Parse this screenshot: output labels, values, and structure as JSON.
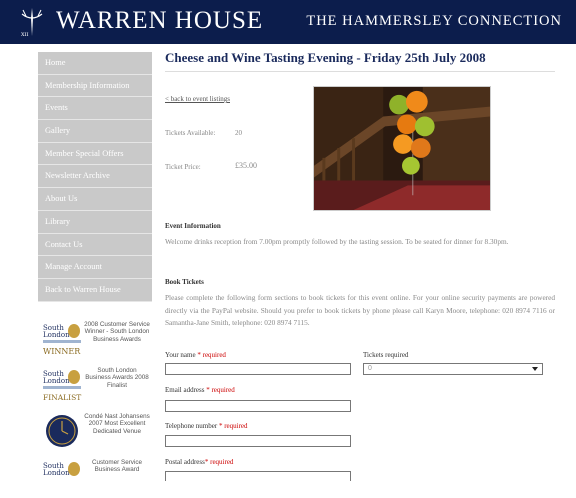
{
  "header": {
    "title": "WARREN HOUSE",
    "subtitle": "THE HAMMERSLEY CONNECTION",
    "colors": {
      "header_bg": "#0c1d4c",
      "nav_bg": "#c9c9c9",
      "title": "#1a2a5c",
      "required": "#cc0000"
    }
  },
  "sidebar": {
    "items": [
      {
        "label": "Home"
      },
      {
        "label": "Membership Information"
      },
      {
        "label": "Events"
      },
      {
        "label": "Gallery"
      },
      {
        "label": "Member Special Offers"
      },
      {
        "label": "Newsletter Archive"
      },
      {
        "label": "About Us"
      },
      {
        "label": "Library"
      },
      {
        "label": "Contact Us"
      },
      {
        "label": "Manage Account"
      },
      {
        "label": "Back to Warren House"
      }
    ],
    "awards": [
      {
        "logo": "South London Business Awards winner logo",
        "text": "2008 Customer Service Winner - South London Business Awards"
      },
      {
        "logo": "South London Business Awards finalist logo",
        "text": "South London Business Awards 2008 Finalist"
      },
      {
        "logo": "Conde Nast Johansens clock seal",
        "text": "Condé Nast Johansens 2007 Most Excellent Dedicated Venue"
      },
      {
        "logo": "South London Business Awards logo",
        "text": "Customer Service Business Award"
      }
    ]
  },
  "main": {
    "title": "Cheese and Wine Tasting Evening - Friday 25th July 2008",
    "back_link": "< back to event listings",
    "tickets_available_label": "Tickets Available:",
    "tickets_available_value": "20",
    "ticket_price_label": "Ticket Price:",
    "ticket_price_value": "£35.00",
    "event_info_heading": "Event Information",
    "event_info_text": "Welcome drinks reception from 7.00pm promptly followed by the tasting session. To be seated for dinner for 8.30pm.",
    "book_heading": "Book Tickets",
    "book_text": "Please complete the following form sections to book tickets for this event online. For your online security payments are powered directly via the PayPal website. Should you prefer to book tickets by phone please call Karyn Moore, telephone: 020 8974 7116 or Samantha-Jane Smith, telephone: 020 8974 7115.",
    "form": {
      "name_label": "Your name",
      "email_label": "Email address",
      "phone_label": "Telephone number",
      "postal_label": "Postal address",
      "required_text": "* required",
      "tickets_label": "Tickets required",
      "tickets_value": "0"
    },
    "photo_icon": "balloons-on-staircase-photo"
  }
}
